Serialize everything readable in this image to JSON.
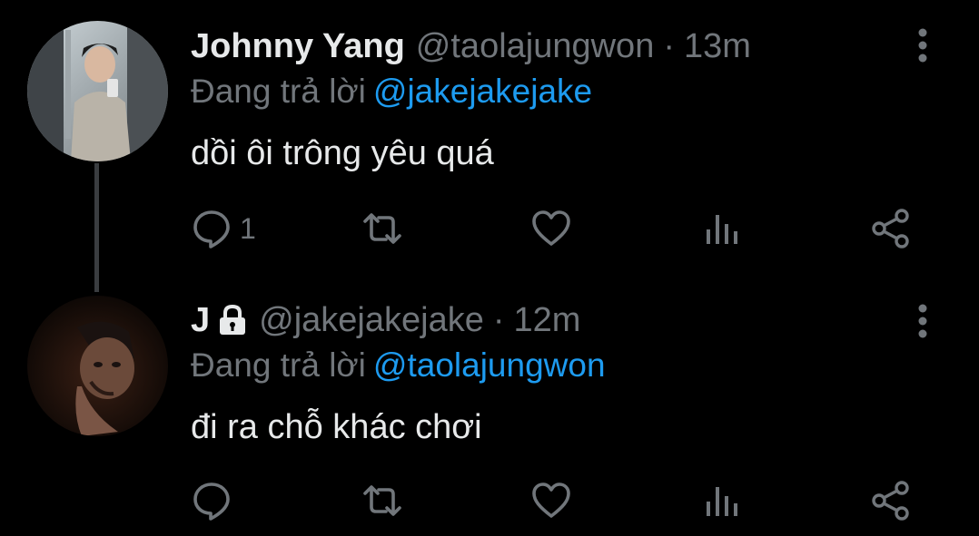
{
  "colors": {
    "background": "#000000",
    "text_primary": "#e7e9ea",
    "text_secondary": "#71767b",
    "link": "#1d9bf0",
    "thread_line": "#3a3d40"
  },
  "tweets": [
    {
      "display_name": "Johnny Yang",
      "handle": "@taolajungwon",
      "separator": "·",
      "time": "13m",
      "replying_label": "Đang trả lời",
      "replying_to": "@jakejakejake",
      "text": "dồi ôi trông yêu quá",
      "reply_count": "1",
      "protected": false,
      "icons": [
        "reply-icon",
        "retweet-icon",
        "like-icon",
        "views-icon",
        "share-icon",
        "more-icon"
      ]
    },
    {
      "display_name": "J",
      "handle": "@jakejakejake",
      "separator": "·",
      "time": "12m",
      "replying_label": "Đang trả lời",
      "replying_to": "@taolajungwon",
      "text": "đi ra chỗ khác chơi",
      "reply_count": "",
      "protected": true,
      "icons": [
        "lock-icon",
        "reply-icon",
        "retweet-icon",
        "like-icon",
        "views-icon",
        "share-icon",
        "more-icon"
      ]
    }
  ]
}
